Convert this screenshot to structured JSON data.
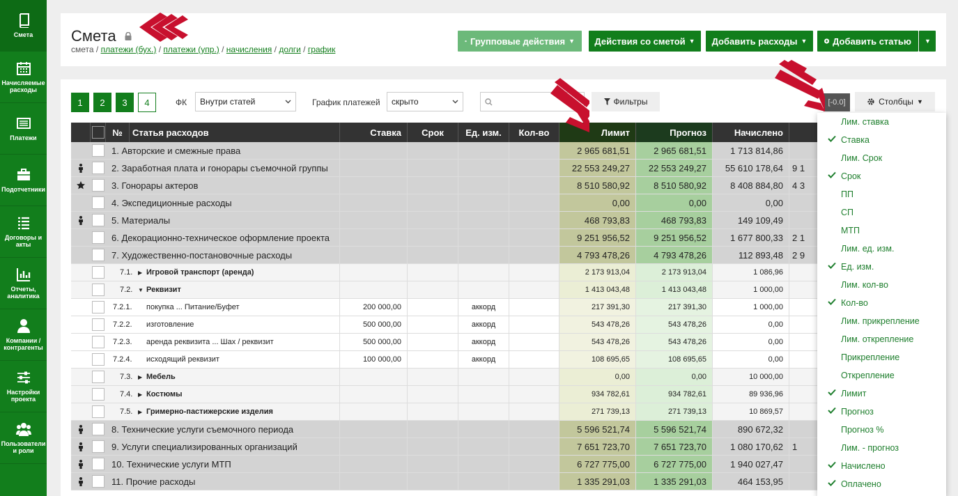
{
  "sidebar": {
    "items": [
      {
        "label": "Смета",
        "icon": "book-icon"
      },
      {
        "label": "Начисляемые расходы",
        "icon": "calendar-icon"
      },
      {
        "label": "Платежи",
        "icon": "list-icon"
      },
      {
        "label": "Подотчетники",
        "icon": "briefcase-icon"
      },
      {
        "label": "Договоры и акты",
        "icon": "document-list-icon"
      },
      {
        "label": "Отчеты, аналитика",
        "icon": "chart-icon"
      },
      {
        "label": "Компании / контрагенты",
        "icon": "person-icon"
      },
      {
        "label": "Настройки проекта",
        "icon": "sliders-icon"
      },
      {
        "label": "Пользователи и роли",
        "icon": "users-icon"
      }
    ]
  },
  "header": {
    "title": "Смета",
    "breadcrumb": {
      "current": "смета",
      "links": [
        "платежи (бух.)",
        "платежи (упр.)",
        "начисления",
        "долги",
        "график"
      ]
    },
    "buttons": {
      "group": "Групповые действия",
      "actions": "Действия со сметой",
      "add_expenses": "Добавить расходы",
      "add_article": "Добавить статью"
    }
  },
  "toolbar": {
    "levels": [
      "1",
      "2",
      "3",
      "4"
    ],
    "fk_label": "ФК",
    "fk_value": "Внутри статей",
    "schedule_label": "График платежей",
    "schedule_value": "скрыто",
    "filters": "Фильтры",
    "range": "[-0.0]",
    "columns": "Столбцы"
  },
  "table": {
    "headers": {
      "num": "№",
      "name": "Статья расходов",
      "rate": "Ставка",
      "term": "Срок",
      "unit": "Ед. изм.",
      "qty": "Кол-во",
      "limit": "Лимит",
      "forecast": "Прогноз",
      "accrued": "Начислено"
    },
    "rows": [
      {
        "level": "top",
        "icon": "",
        "name": "1. Авторские и смежные права",
        "rate": "",
        "unit": "",
        "limit": "2 965 681,51",
        "forecast": "2 965 681,51",
        "accrued": "1 713 814,86",
        "extra": ""
      },
      {
        "level": "top",
        "icon": "person",
        "name": "2. Заработная плата и гонорары съемочной группы",
        "rate": "",
        "unit": "",
        "limit": "22 553 249,27",
        "forecast": "22 553 249,27",
        "accrued": "55 610 178,64",
        "extra": "9 1"
      },
      {
        "level": "top",
        "icon": "star",
        "name": "3. Гонорары актеров",
        "rate": "",
        "unit": "",
        "limit": "8 510 580,92",
        "forecast": "8 510 580,92",
        "accrued": "8 408 884,80",
        "extra": "4 3"
      },
      {
        "level": "top",
        "icon": "",
        "name": "4. Экспедиционные расходы",
        "rate": "",
        "unit": "",
        "limit": "0,00",
        "forecast": "0,00",
        "accrued": "0,00",
        "extra": ""
      },
      {
        "level": "top",
        "icon": "person",
        "name": "5. Материалы",
        "rate": "",
        "unit": "",
        "limit": "468 793,83",
        "forecast": "468 793,83",
        "accrued": "149 109,49",
        "extra": ""
      },
      {
        "level": "top",
        "icon": "",
        "name": "6. Декорационно-техническое оформление проекта",
        "rate": "",
        "unit": "",
        "limit": "9 251 956,52",
        "forecast": "9 251 956,52",
        "accrued": "1 677 800,33",
        "extra": "2 1"
      },
      {
        "level": "top",
        "icon": "",
        "name": "7. Художественно-постановочные расходы",
        "rate": "",
        "unit": "",
        "limit": "4 793 478,26",
        "forecast": "4 793 478,26",
        "accrued": "112 893,48",
        "extra": "2 9"
      },
      {
        "level": "mid",
        "num": "7.1.",
        "tri": "▶",
        "name": "Игровой транспорт (аренда)",
        "rate": "",
        "unit": "",
        "limit": "2 173 913,04",
        "forecast": "2 173 913,04",
        "accrued": "1 086,96",
        "extra": ""
      },
      {
        "level": "mid",
        "num": "7.2.",
        "tri": "▼",
        "name": "Реквизит",
        "rate": "",
        "unit": "",
        "limit": "1 413 043,48",
        "forecast": "1 413 043,48",
        "accrued": "1 000,00",
        "extra": ""
      },
      {
        "level": "low",
        "num": "7.2.1.",
        "name": "покупка ... Питание/Буфет",
        "rate": "200 000,00",
        "unit": "аккорд",
        "limit": "217 391,30",
        "forecast": "217 391,30",
        "accrued": "1 000,00",
        "extra": ""
      },
      {
        "level": "low",
        "num": "7.2.2.",
        "name": "изготовление",
        "rate": "500 000,00",
        "unit": "аккорд",
        "limit": "543 478,26",
        "forecast": "543 478,26",
        "accrued": "0,00",
        "extra": ""
      },
      {
        "level": "low",
        "num": "7.2.3.",
        "name": "аренда реквизита ... Шах / реквизит",
        "rate": "500 000,00",
        "unit": "аккорд",
        "limit": "543 478,26",
        "forecast": "543 478,26",
        "accrued": "0,00",
        "extra": ""
      },
      {
        "level": "low",
        "num": "7.2.4.",
        "name": "исходящий реквизит",
        "rate": "100 000,00",
        "unit": "аккорд",
        "limit": "108 695,65",
        "forecast": "108 695,65",
        "accrued": "0,00",
        "extra": ""
      },
      {
        "level": "mid",
        "num": "7.3.",
        "tri": "▶",
        "name": "Мебель",
        "rate": "",
        "unit": "",
        "limit": "0,00",
        "forecast": "0,00",
        "accrued": "10 000,00",
        "extra": ""
      },
      {
        "level": "mid",
        "num": "7.4.",
        "tri": "▶",
        "name": "Костюмы",
        "rate": "",
        "unit": "",
        "limit": "934 782,61",
        "forecast": "934 782,61",
        "accrued": "89 936,96",
        "extra": ""
      },
      {
        "level": "mid",
        "num": "7.5.",
        "tri": "▶",
        "name": "Гримерно-пастижерские изделия",
        "rate": "",
        "unit": "",
        "limit": "271 739,13",
        "forecast": "271 739,13",
        "accrued": "10 869,57",
        "extra": ""
      },
      {
        "level": "top",
        "icon": "person",
        "name": "8. Технические услуги съемочного периода",
        "rate": "",
        "unit": "",
        "limit": "5 596 521,74",
        "forecast": "5 596 521,74",
        "accrued": "890 672,32",
        "extra": ""
      },
      {
        "level": "top",
        "icon": "person",
        "name": "9. Услуги специализированных организаций",
        "rate": "",
        "unit": "",
        "limit": "7 651 723,70",
        "forecast": "7 651 723,70",
        "accrued": "1 080 170,62",
        "extra": "1"
      },
      {
        "level": "top",
        "icon": "person",
        "name": "10. Технические услуги МТП",
        "rate": "",
        "unit": "",
        "limit": "6 727 775,00",
        "forecast": "6 727 775,00",
        "accrued": "1 940 027,47",
        "extra": ""
      },
      {
        "level": "top",
        "icon": "person",
        "name": "11. Прочие расходы",
        "rate": "",
        "unit": "",
        "limit": "1 335 291,03",
        "forecast": "1 335 291,03",
        "accrued": "464 153,95",
        "extra": ""
      }
    ]
  },
  "columns_menu": [
    {
      "label": "Лим. ставка",
      "checked": false
    },
    {
      "label": "Ставка",
      "checked": true
    },
    {
      "label": "Лим. Срок",
      "checked": false
    },
    {
      "label": "Срок",
      "checked": true
    },
    {
      "label": "ПП",
      "checked": false
    },
    {
      "label": "СП",
      "checked": false
    },
    {
      "label": "МТП",
      "checked": false
    },
    {
      "label": "Лим. ед. изм.",
      "checked": false
    },
    {
      "label": "Ед. изм.",
      "checked": true
    },
    {
      "label": "Лим. кол-во",
      "checked": false
    },
    {
      "label": "Кол-во",
      "checked": true
    },
    {
      "label": "Лим. прикрепление",
      "checked": false
    },
    {
      "label": "Лим. открепление",
      "checked": false
    },
    {
      "label": "Прикрепление",
      "checked": false
    },
    {
      "label": "Открепление",
      "checked": false
    },
    {
      "label": "Лимит",
      "checked": true
    },
    {
      "label": "Прогноз",
      "checked": true
    },
    {
      "label": "Прогноз %",
      "checked": false
    },
    {
      "label": "Лим. - прогноз",
      "checked": false
    },
    {
      "label": "Начислено",
      "checked": true
    },
    {
      "label": "Оплачено",
      "checked": true
    }
  ],
  "colors": {
    "brand": "#127e1c",
    "brand_light": "#6cb97a",
    "annotation": "#c8102e"
  }
}
